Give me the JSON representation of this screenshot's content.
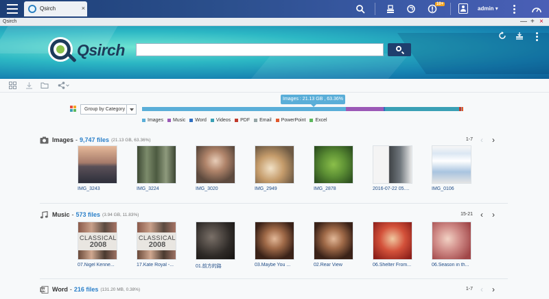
{
  "app_tab": {
    "title": "Qsirch",
    "close": "×"
  },
  "topbar": {
    "notification_count": "10+",
    "username": "admin ▾"
  },
  "window": {
    "title": "Qsirch",
    "minimize": "—",
    "maximize": "+",
    "close": "×"
  },
  "hero": {
    "brand": "Qsirch",
    "search_placeholder": ""
  },
  "group": {
    "selected": "Group by Category"
  },
  "storage": {
    "tooltip": "Images : 21.13 GB , 63.36%",
    "segments": [
      {
        "label": "Images",
        "color": "#5aaed8",
        "fraction": 0.6336
      },
      {
        "label": "Music",
        "color": "#9b59b6",
        "fraction": 0.1183
      },
      {
        "label": "Word",
        "color": "#2f6fc2",
        "fraction": 0.0038
      },
      {
        "label": "Videos",
        "color": "#3aa0b5",
        "fraction": 0.23
      },
      {
        "label": "PDF",
        "color": "#c0392b",
        "fraction": 0.006
      },
      {
        "label": "Email",
        "color": "#95a5a6",
        "fraction": 0.002
      },
      {
        "label": "PowerPoint",
        "color": "#e0572b",
        "fraction": 0.004
      },
      {
        "label": "Excel",
        "color": "#5cb85c",
        "fraction": 0.002
      }
    ]
  },
  "sections": [
    {
      "title": "Images",
      "count": "9,747 files",
      "meta": "(21.13 GB, 63.36%)",
      "range": "1-7",
      "items": [
        "IMG_3243",
        "IMG_3224",
        "IMG_3020",
        "IMG_2949",
        "IMG_2878",
        "2016-07-22 05....",
        "IMG_0106"
      ]
    },
    {
      "title": "Music",
      "count": "573 files",
      "meta": "(3.94 GB, 11.83%)",
      "range": "15-21",
      "items": [
        "07.Nigel Kenne...",
        "17.Kate Royal -...",
        "01.前方的路",
        "03.Maybe You ...",
        "02.Rear View",
        "06.Shelter From...",
        "06.Season in th..."
      ]
    },
    {
      "title": "Word",
      "count": "216 files",
      "meta": "(131.20 MB, 0.38%)",
      "range": "1-7"
    }
  ],
  "album_text": {
    "classical": "CLASSICAL",
    "year": "2008"
  }
}
